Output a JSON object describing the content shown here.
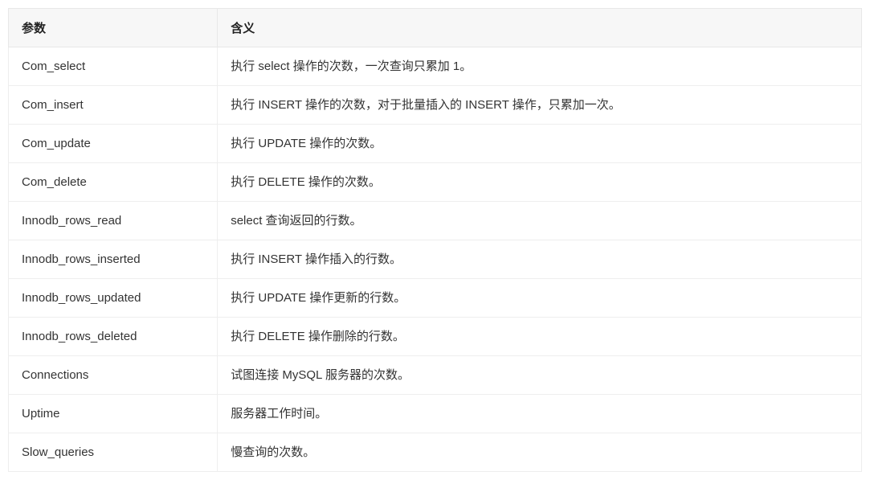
{
  "table": {
    "headers": {
      "param": "参数",
      "meaning": "含义"
    },
    "rows": [
      {
        "param": "Com_select",
        "meaning": "执行 select 操作的次数，一次查询只累加 1。"
      },
      {
        "param": "Com_insert",
        "meaning": "执行 INSERT 操作的次数，对于批量插入的 INSERT 操作，只累加一次。"
      },
      {
        "param": "Com_update",
        "meaning": "执行 UPDATE 操作的次数。"
      },
      {
        "param": "Com_delete",
        "meaning": "执行 DELETE 操作的次数。"
      },
      {
        "param": "Innodb_rows_read",
        "meaning": "select 查询返回的行数。"
      },
      {
        "param": "Innodb_rows_inserted",
        "meaning": "执行 INSERT 操作插入的行数。"
      },
      {
        "param": "Innodb_rows_updated",
        "meaning": "执行 UPDATE 操作更新的行数。"
      },
      {
        "param": "Innodb_rows_deleted",
        "meaning": "执行 DELETE 操作删除的行数。"
      },
      {
        "param": "Connections",
        "meaning": "试图连接 MySQL 服务器的次数。"
      },
      {
        "param": "Uptime",
        "meaning": "服务器工作时间。"
      },
      {
        "param": "Slow_queries",
        "meaning": "慢查询的次数。"
      }
    ]
  }
}
